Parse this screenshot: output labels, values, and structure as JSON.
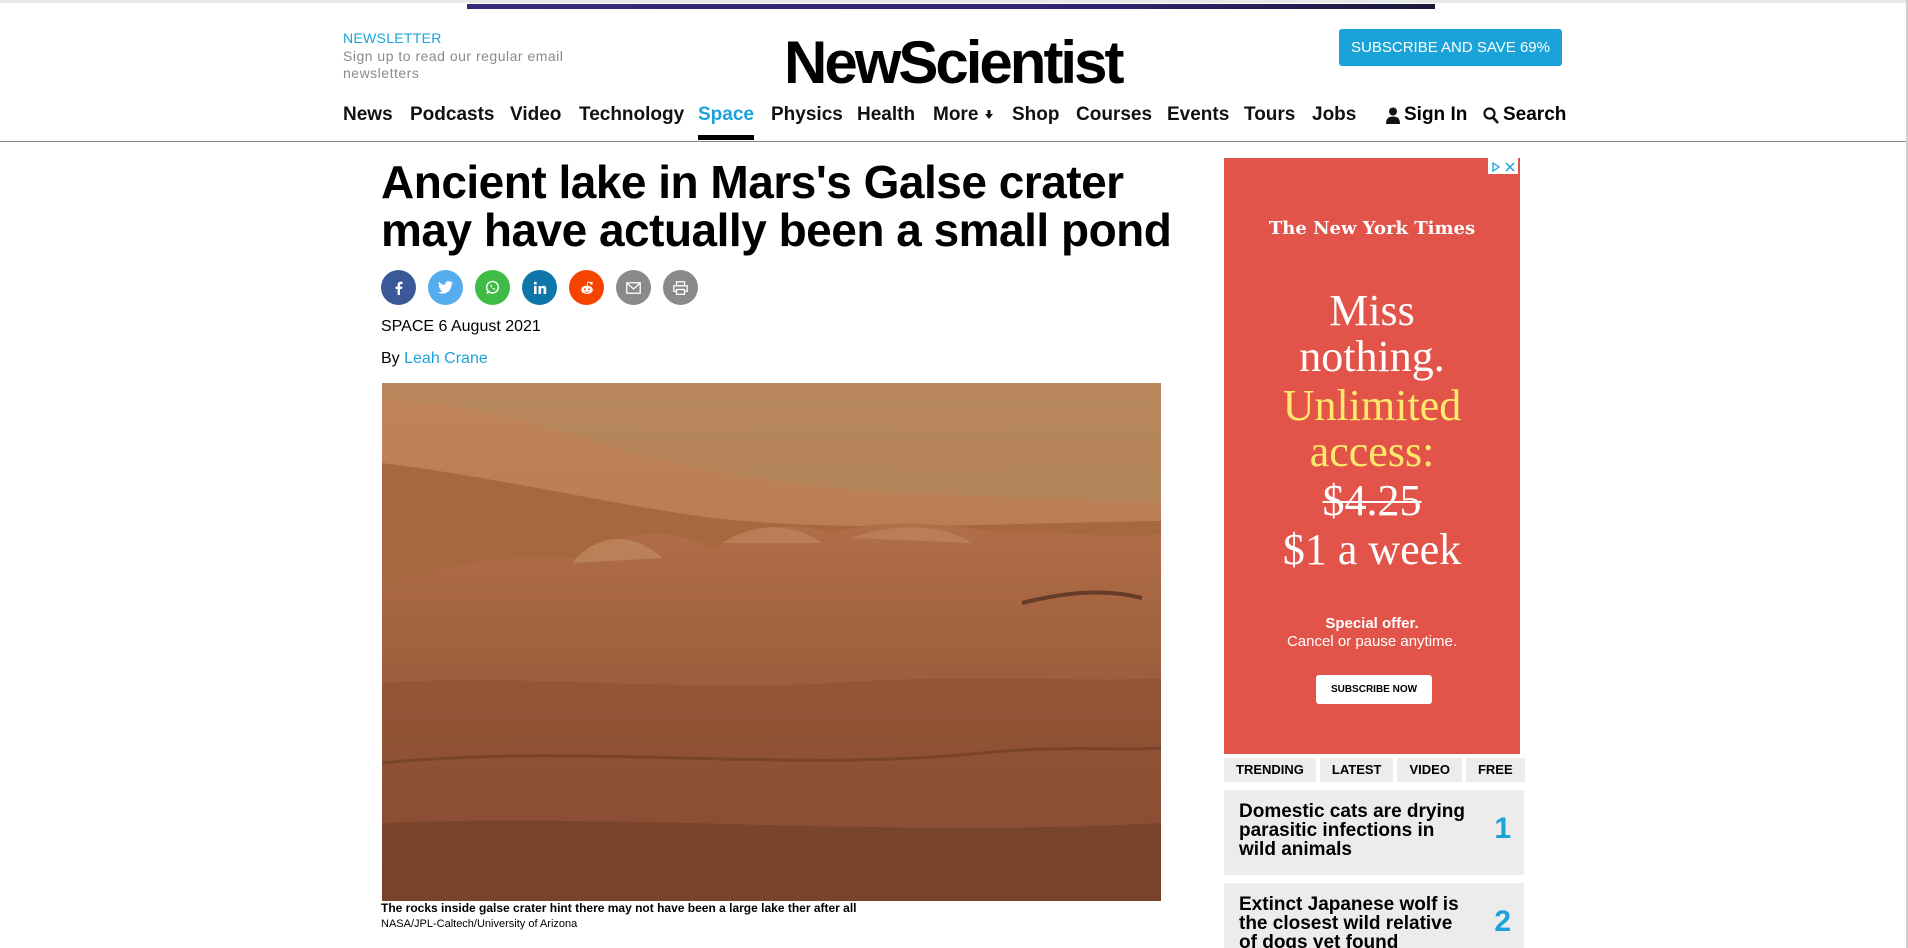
{
  "header": {
    "newsletter_title": "NEWSLETTER",
    "newsletter_sub": "Sign up to read our regular email newsletters",
    "logo": "NewScientist",
    "subscribe": "SUBSCRIBE AND SAVE 69%"
  },
  "nav": {
    "items": [
      "News",
      "Podcasts",
      "Video",
      "Technology",
      "Space",
      "Physics",
      "Health",
      "More",
      "Shop",
      "Courses",
      "Events",
      "Tours",
      "Jobs"
    ],
    "active": "Space",
    "sign_in": "Sign In",
    "search": "Search"
  },
  "article": {
    "headline": "Ancient lake in Mars's Galse crater may have actually been a small pond",
    "section": "SPACE",
    "date": "6 August 2021",
    "by": "By",
    "author": "Leah Crane",
    "caption": "The rocks inside galse crater hint there may not have been a large lake ther after all",
    "credit": "NASA/JPL-Caltech/University of Arizona",
    "share_icons": [
      "facebook-icon",
      "twitter-icon",
      "whatsapp-icon",
      "linkedin-icon",
      "reddit-icon",
      "email-icon",
      "print-icon"
    ]
  },
  "ad": {
    "brand": "The New York Times",
    "line1": "Miss",
    "line2": "nothing.",
    "line3": "Unlimited",
    "line4": "access:",
    "old_price": "$4.25",
    "new_price": "$1 a week",
    "offer1": "Special offer.",
    "offer2": "Cancel or pause anytime.",
    "button": "SUBSCRIBE NOW"
  },
  "sidebar": {
    "tabs": [
      "TRENDING",
      "LATEST",
      "VIDEO",
      "FREE"
    ],
    "items": [
      {
        "title": "Domestic cats are drying parasitic infections in wild animals",
        "num": "1"
      },
      {
        "title": "Extinct Japanese wolf is the closest wild relative of dogs yet found",
        "num": "2"
      }
    ]
  },
  "colors": {
    "accent": "#1aa3d9",
    "ad_bg": "#e2544a"
  }
}
